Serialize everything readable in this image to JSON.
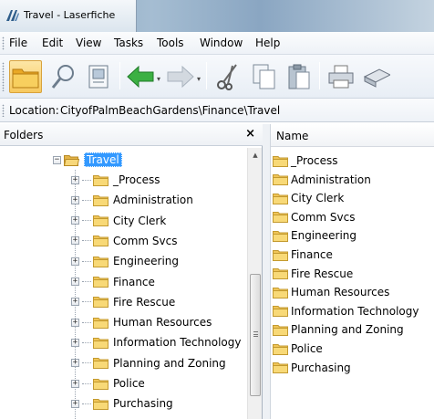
{
  "window": {
    "title": "Travel - Laserfiche",
    "icon": "laserfiche-icon"
  },
  "menu": [
    "File",
    "Edit",
    "View",
    "Tasks",
    "Tools",
    "Window",
    "Help"
  ],
  "toolbar": {
    "buttons": [
      "browse-folder",
      "search",
      "properties",
      "back",
      "forward",
      "cut",
      "copy",
      "paste",
      "print",
      "scan"
    ]
  },
  "location": {
    "label": "Location:",
    "path": "CityofPalmBeachGardens\\Finance\\Travel"
  },
  "folders_pane": {
    "title": "Folders",
    "close": "×",
    "tree": {
      "root": {
        "label": "Travel",
        "expander": "−",
        "selected": true
      },
      "children": [
        {
          "label": "_Process",
          "expander": "+"
        },
        {
          "label": "Administration",
          "expander": "+"
        },
        {
          "label": "City Clerk",
          "expander": "+"
        },
        {
          "label": "Comm Svcs",
          "expander": "+"
        },
        {
          "label": "Engineering",
          "expander": "+"
        },
        {
          "label": "Finance",
          "expander": "+"
        },
        {
          "label": "Fire Rescue",
          "expander": "+"
        },
        {
          "label": "Human Resources",
          "expander": "+"
        },
        {
          "label": "Information Technology",
          "expander": "+"
        },
        {
          "label": "Planning and Zoning",
          "expander": "+"
        },
        {
          "label": "Police",
          "expander": "+"
        },
        {
          "label": "Purchasing",
          "expander": "+"
        }
      ]
    }
  },
  "name_pane": {
    "column_header": "Name",
    "items": [
      "_Process",
      "Administration",
      "City Clerk",
      "Comm Svcs",
      "Engineering",
      "Finance",
      "Fire Rescue",
      "Human Resources",
      "Information Technology",
      "Planning and Zoning",
      "Police",
      "Purchasing"
    ]
  },
  "colors": {
    "selection": "#3399ff",
    "folder": "#f2c55c",
    "back_arrow": "#3cb043"
  }
}
